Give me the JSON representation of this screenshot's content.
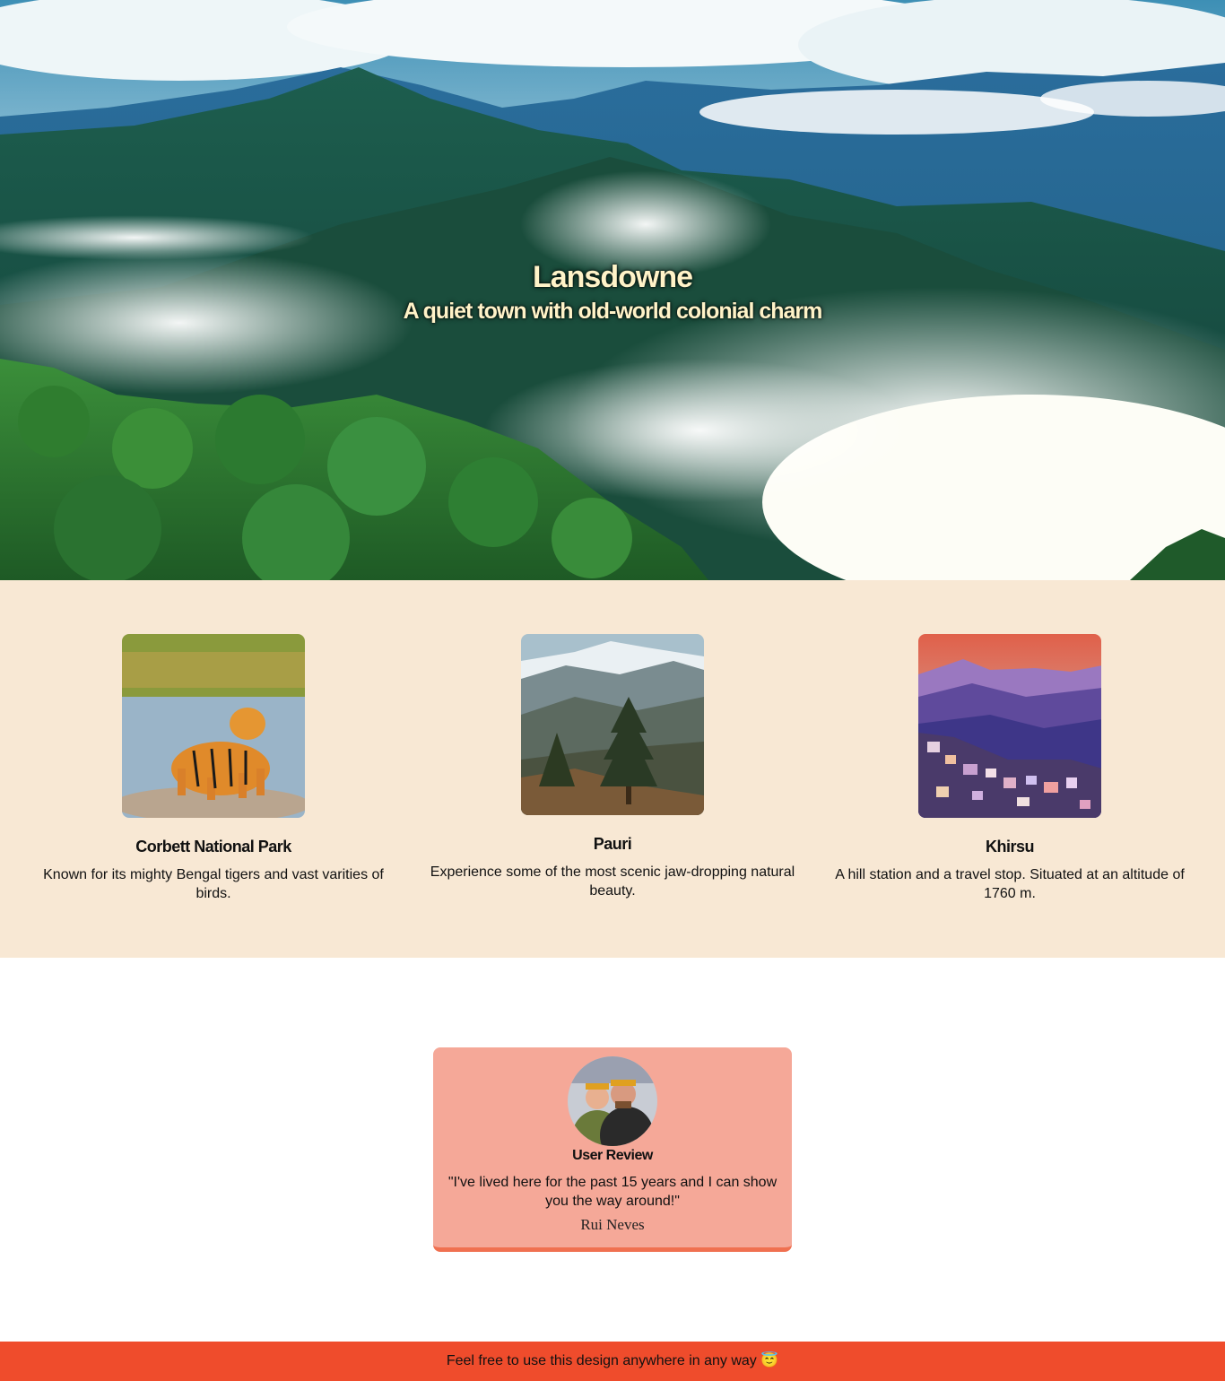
{
  "hero": {
    "title": "Lansdowne",
    "subtitle": "A quiet town with old-world colonial charm"
  },
  "places": [
    {
      "name": "Corbett National Park",
      "description": "Known for its mighty Bengal tigers and vast varities of birds.",
      "image": "tiger-photo"
    },
    {
      "name": "Pauri",
      "description": "Experience some of the most scenic jaw-dropping natural beauty.",
      "image": "mountain-pine-photo"
    },
    {
      "name": "Khirsu",
      "description": "A hill station and a travel stop. Situated at an altitude of 1760 m.",
      "image": "hill-town-sunset-photo"
    }
  ],
  "review": {
    "heading": "User Review",
    "quote": "\"I've lived here for the past 15 years and I can show you the way around!\"",
    "author": "Rui Neves"
  },
  "footer": {
    "text": "Feel free to use this design anywhere in any way 😇"
  },
  "colors": {
    "places_bg": "#f8e8d4",
    "review_bg": "#f5a898",
    "review_border": "#f07050",
    "footer_bg": "#ef4c2c"
  }
}
